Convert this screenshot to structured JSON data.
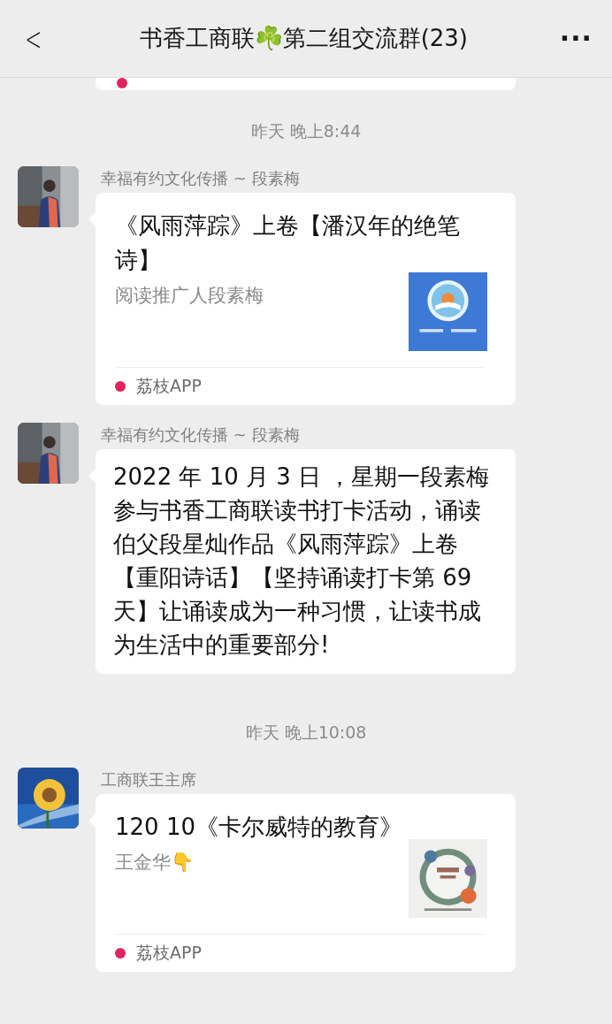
{
  "header": {
    "back": "<",
    "title": "书香工商联☘️第二组交流群(23)",
    "more": "···"
  },
  "messages": [
    {
      "kind": "partial_card"
    },
    {
      "kind": "time",
      "text": "昨天 晚上8:44"
    },
    {
      "kind": "link_card",
      "sender": "幸福有约文化传播 ~ 段素梅",
      "title": "《风雨萍踪》上卷【潘汉年的绝笔诗】",
      "desc": "阅读推广人段素梅",
      "source": "荔枝APP"
    },
    {
      "kind": "text",
      "sender": "幸福有约文化传播 ~ 段素梅",
      "text": "2022 年 10 月 3 日 ，星期一段素梅参与书香工商联读书打卡活动，诵读伯父段星灿作品《风雨萍踪》上卷【重阳诗话】【坚持诵读打卡第 69 天】让诵读成为一种习惯，让读书成为生活中的重要部分!"
    },
    {
      "kind": "time",
      "text": "昨天 晚上10:08"
    },
    {
      "kind": "link_card",
      "sender": "工商联王主席",
      "title": "120  10《卡尔威特的教育》",
      "desc": "王金华👇",
      "source": "荔枝APP"
    }
  ]
}
